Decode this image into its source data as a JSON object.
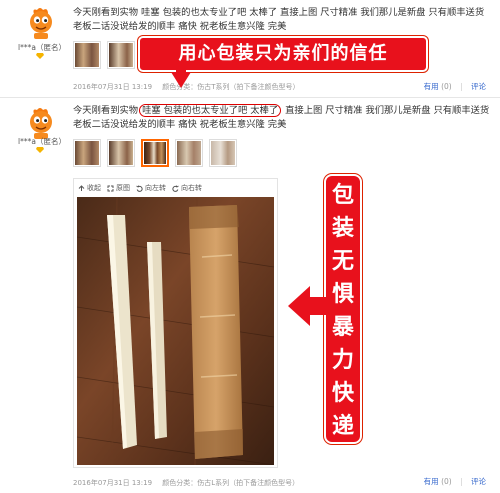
{
  "reviews": [
    {
      "user": "l***a（匿名）",
      "text": "今天刚看到实物 哇塞 包装的也太专业了吧 太棒了 直接上图 尺寸精准 我们那儿是新盘 只有顺丰送货 老板二话没说给发的顺丰 痛快 祝老板生意兴隆 完美",
      "date": "2016年07月31日 13:19",
      "category": "颜色分类：伤古T系列（拍下备注颜色型号）",
      "useful_label": "有用",
      "useful_count": "(0)",
      "reply_label": "评论"
    },
    {
      "user": "l***a（匿名）",
      "text_before": "今天刚看到实物",
      "text_highlight": "哇塞 包装的也太专业了吧 太棒了",
      "text_after": " 直接上图 尺寸精准 我们那儿是新盘 只有顺丰送货 老板二话没说给发的顺丰 痛快 祝老板生意兴隆 完美",
      "date": "2016年07月31日 13:19",
      "category": "颜色分类：伤古L系列（拍下备注颜色型号）",
      "useful_label": "有用",
      "useful_count": "(0)",
      "reply_label": "评论"
    }
  ],
  "viewer_toolbar": {
    "collapse": "收起",
    "original": "原图",
    "rotate_left": "向左转",
    "rotate_right": "向右转"
  },
  "annotations": {
    "top_banner": "用心包装只为亲们的信任",
    "side_banner": [
      "包",
      "装",
      "无",
      "惧",
      "暴",
      "力",
      "快",
      "递"
    ],
    "accent_color": "#e8111c"
  },
  "icons": [
    "mascot-avatar-icon",
    "vip-diamond-icon",
    "collapse-icon",
    "fullsize-icon",
    "rotate-left-icon",
    "rotate-right-icon"
  ]
}
